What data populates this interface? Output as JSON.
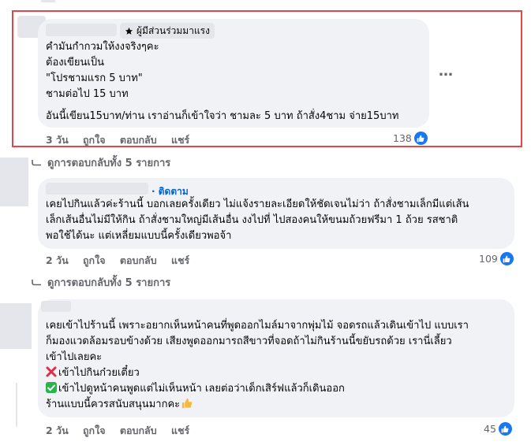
{
  "comment1": {
    "badge": "ผู้มีส่วนร่วมมาแรง",
    "lines": [
      "คำมันกำกวมให้งงจริงๆคะ",
      "ต้องเขียนเป็น",
      "\"โปรชามแรก 5 บาท\"",
      "ชามต่อไป 15 บาท",
      "อันนี้เขียน15บาท/ท่าน เราอ่านก็เข้าใจว่า ชามละ 5 บาท ถ้าสั่ง4ชาม จ่าย15บาท"
    ],
    "more": "…",
    "time": "3 วัน",
    "like": "ถูกใจ",
    "reply": "ตอบกลับ",
    "share": "แชร์",
    "reactions": "138"
  },
  "replies1": {
    "label": "ดูการตอบกลับทั้ง 5 รายการ"
  },
  "comment2": {
    "follow": "· ติดตาม",
    "lines": [
      "เคยไปกินแล้วค่ะร้านนี้ บอกเลยครั้งเดียว ไม่แจ้งรายละเอียดให้ชัดเจนไม่ว่า ถ้าสั่งชามเล็กมีแต่เส้น",
      "เล็กเส้นอื่นไม่มีให้กิน ถ้าสั่งชามใหญ่มีเส้นอื่น งงไปที่ ไปสองคนให้ขนมถ้วยฟรีมา 1 ถ้วย รสชาติ",
      "พอใช้ได้นะ แต่เหลี่ยมแบบนี้ครั้งเดียวพอจ้า"
    ],
    "time": "2 วัน",
    "like": "ถูกใจ",
    "reply": "ตอบกลับ",
    "share": "แชร์",
    "reactions": "109"
  },
  "replies2": {
    "label": "ดูการตอบกลับทั้ง 5 รายการ"
  },
  "comment3": {
    "lines": [
      "เคยเข้าไปร้านนี้ เพราะอยากเห็นหน้าคนที่พูดออกไมล์มาจากพุ่มไม้ จอดรถแล้วเดินเข้าไป แบบเรา",
      "ก็มองแวดล้อมรอบข้างด้วย เสียงพูดออกมารถสีขาวที่จอดถ้าไม่กินร้านนี้ขยับรถด้วย เรานี่เลี้ยว",
      "เข้าไปเลยคะ"
    ],
    "line_x": "เข้าไปกินก๋วยเตี๋ยว",
    "line_check": "เข้าไปดูหน้าคนพูดแต่ไม่เห็นหน้า เลยต่อว่าเด็กเสิร์ฟแล้วก็เดินออก",
    "line_last": "ร้านแบบนี้ควรสนับสนุนมากคะ",
    "time": "2 วัน",
    "like": "ถูกใจ",
    "reply": "ตอบกลับ",
    "share": "แชร์",
    "reactions": "45"
  },
  "colors": {
    "bubble": "#f0f2f5",
    "meta": "#65676b",
    "link": "#0064d1",
    "like_blue": "#1877f2",
    "highlight_border": "#e0474c"
  },
  "icons": [
    "star-badge-icon",
    "more-options-icon",
    "like-thumb-icon",
    "reply-arrow-icon",
    "cross-mark-icon",
    "check-mark-icon",
    "thumbs-up-emoji-icon"
  ]
}
